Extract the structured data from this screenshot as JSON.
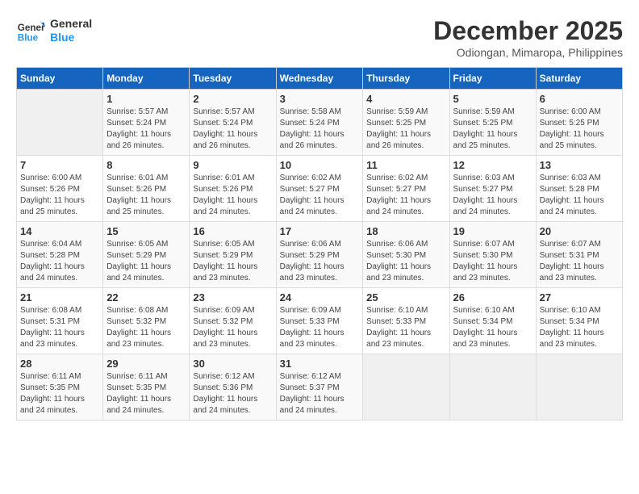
{
  "header": {
    "logo_line1": "General",
    "logo_line2": "Blue",
    "month": "December 2025",
    "location": "Odiongan, Mimaropa, Philippines"
  },
  "weekdays": [
    "Sunday",
    "Monday",
    "Tuesday",
    "Wednesday",
    "Thursday",
    "Friday",
    "Saturday"
  ],
  "weeks": [
    [
      {
        "day": "",
        "info": ""
      },
      {
        "day": "1",
        "info": "Sunrise: 5:57 AM\nSunset: 5:24 PM\nDaylight: 11 hours and 26 minutes."
      },
      {
        "day": "2",
        "info": "Sunrise: 5:57 AM\nSunset: 5:24 PM\nDaylight: 11 hours and 26 minutes."
      },
      {
        "day": "3",
        "info": "Sunrise: 5:58 AM\nSunset: 5:24 PM\nDaylight: 11 hours and 26 minutes."
      },
      {
        "day": "4",
        "info": "Sunrise: 5:59 AM\nSunset: 5:25 PM\nDaylight: 11 hours and 26 minutes."
      },
      {
        "day": "5",
        "info": "Sunrise: 5:59 AM\nSunset: 5:25 PM\nDaylight: 11 hours and 25 minutes."
      },
      {
        "day": "6",
        "info": "Sunrise: 6:00 AM\nSunset: 5:25 PM\nDaylight: 11 hours and 25 minutes."
      }
    ],
    [
      {
        "day": "7",
        "info": "Sunrise: 6:00 AM\nSunset: 5:26 PM\nDaylight: 11 hours and 25 minutes."
      },
      {
        "day": "8",
        "info": "Sunrise: 6:01 AM\nSunset: 5:26 PM\nDaylight: 11 hours and 25 minutes."
      },
      {
        "day": "9",
        "info": "Sunrise: 6:01 AM\nSunset: 5:26 PM\nDaylight: 11 hours and 24 minutes."
      },
      {
        "day": "10",
        "info": "Sunrise: 6:02 AM\nSunset: 5:27 PM\nDaylight: 11 hours and 24 minutes."
      },
      {
        "day": "11",
        "info": "Sunrise: 6:02 AM\nSunset: 5:27 PM\nDaylight: 11 hours and 24 minutes."
      },
      {
        "day": "12",
        "info": "Sunrise: 6:03 AM\nSunset: 5:27 PM\nDaylight: 11 hours and 24 minutes."
      },
      {
        "day": "13",
        "info": "Sunrise: 6:03 AM\nSunset: 5:28 PM\nDaylight: 11 hours and 24 minutes."
      }
    ],
    [
      {
        "day": "14",
        "info": "Sunrise: 6:04 AM\nSunset: 5:28 PM\nDaylight: 11 hours and 24 minutes."
      },
      {
        "day": "15",
        "info": "Sunrise: 6:05 AM\nSunset: 5:29 PM\nDaylight: 11 hours and 24 minutes."
      },
      {
        "day": "16",
        "info": "Sunrise: 6:05 AM\nSunset: 5:29 PM\nDaylight: 11 hours and 23 minutes."
      },
      {
        "day": "17",
        "info": "Sunrise: 6:06 AM\nSunset: 5:29 PM\nDaylight: 11 hours and 23 minutes."
      },
      {
        "day": "18",
        "info": "Sunrise: 6:06 AM\nSunset: 5:30 PM\nDaylight: 11 hours and 23 minutes."
      },
      {
        "day": "19",
        "info": "Sunrise: 6:07 AM\nSunset: 5:30 PM\nDaylight: 11 hours and 23 minutes."
      },
      {
        "day": "20",
        "info": "Sunrise: 6:07 AM\nSunset: 5:31 PM\nDaylight: 11 hours and 23 minutes."
      }
    ],
    [
      {
        "day": "21",
        "info": "Sunrise: 6:08 AM\nSunset: 5:31 PM\nDaylight: 11 hours and 23 minutes."
      },
      {
        "day": "22",
        "info": "Sunrise: 6:08 AM\nSunset: 5:32 PM\nDaylight: 11 hours and 23 minutes."
      },
      {
        "day": "23",
        "info": "Sunrise: 6:09 AM\nSunset: 5:32 PM\nDaylight: 11 hours and 23 minutes."
      },
      {
        "day": "24",
        "info": "Sunrise: 6:09 AM\nSunset: 5:33 PM\nDaylight: 11 hours and 23 minutes."
      },
      {
        "day": "25",
        "info": "Sunrise: 6:10 AM\nSunset: 5:33 PM\nDaylight: 11 hours and 23 minutes."
      },
      {
        "day": "26",
        "info": "Sunrise: 6:10 AM\nSunset: 5:34 PM\nDaylight: 11 hours and 23 minutes."
      },
      {
        "day": "27",
        "info": "Sunrise: 6:10 AM\nSunset: 5:34 PM\nDaylight: 11 hours and 23 minutes."
      }
    ],
    [
      {
        "day": "28",
        "info": "Sunrise: 6:11 AM\nSunset: 5:35 PM\nDaylight: 11 hours and 24 minutes."
      },
      {
        "day": "29",
        "info": "Sunrise: 6:11 AM\nSunset: 5:35 PM\nDaylight: 11 hours and 24 minutes."
      },
      {
        "day": "30",
        "info": "Sunrise: 6:12 AM\nSunset: 5:36 PM\nDaylight: 11 hours and 24 minutes."
      },
      {
        "day": "31",
        "info": "Sunrise: 6:12 AM\nSunset: 5:37 PM\nDaylight: 11 hours and 24 minutes."
      },
      {
        "day": "",
        "info": ""
      },
      {
        "day": "",
        "info": ""
      },
      {
        "day": "",
        "info": ""
      }
    ]
  ]
}
